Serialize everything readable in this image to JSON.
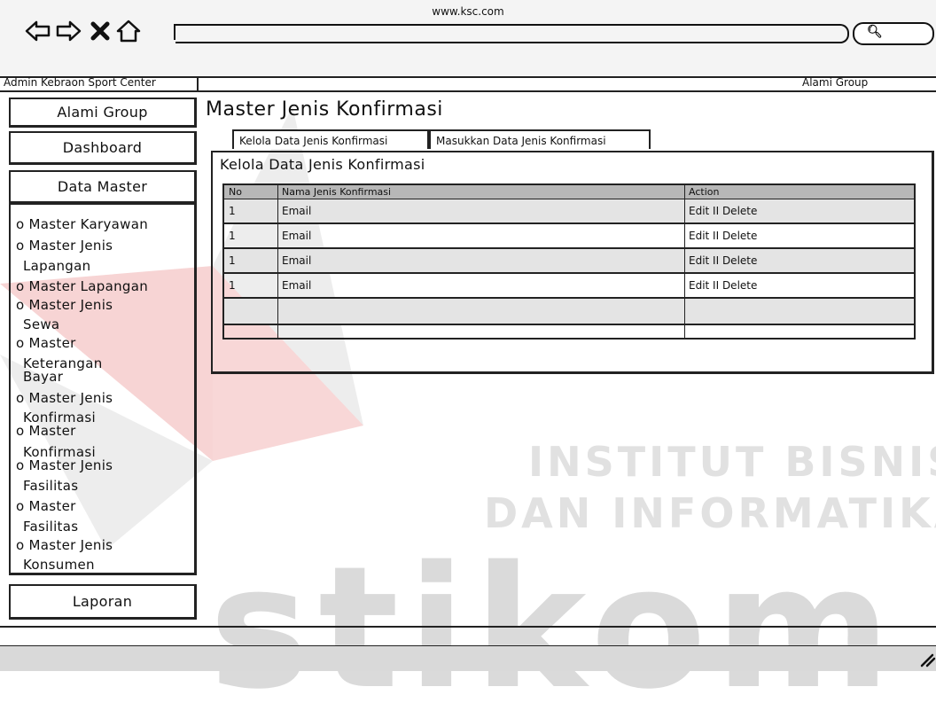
{
  "browser": {
    "url": "www.ksc.com",
    "nav_icons": [
      "back-arrow-icon",
      "forward-arrow-icon",
      "close-icon",
      "home-icon"
    ],
    "search_icon": "search-icon"
  },
  "header": {
    "left": "Admin Kebraon Sport Center",
    "right": "Alami Group"
  },
  "sidebar": {
    "top_buttons": [
      "Alami Group",
      "Dashboard",
      "Data Master"
    ],
    "items": [
      "o Master Karyawan",
      "o Master Jenis",
      "Lapangan",
      "o Master Lapangan",
      "o Master Jenis",
      "Sewa",
      "o Master",
      "Keterangan",
      "Bayar",
      "o Master Jenis",
      "Konfirmasi",
      "o Master",
      "Konfirmasi",
      "o Master Jenis",
      "Fasilitas",
      "o Master",
      "Fasilitas",
      "o Master Jenis",
      "Konsumen"
    ],
    "bottom_button": "Laporan"
  },
  "main": {
    "title": "Master Jenis Konfirmasi",
    "tabs": [
      "Kelola Data Jenis Konfirmasi",
      "Masukkan Data Jenis Konfirmasi"
    ],
    "panel_title": "Kelola Data Jenis Konfirmasi",
    "table": {
      "columns": [
        "No",
        "Nama Jenis Konfirmasi",
        "Action"
      ],
      "rows": [
        [
          "1",
          "Email",
          "Edit II Delete"
        ],
        [
          "1",
          "Email",
          "Edit II Delete"
        ],
        [
          "1",
          "Email",
          "Edit II Delete"
        ],
        [
          "1",
          "Email",
          "Edit II Delete"
        ],
        [
          "",
          "",
          ""
        ],
        [
          "",
          "",
          ""
        ]
      ]
    }
  },
  "watermark": {
    "line1": "INSTITUT BISNIS",
    "line2": "DAN INFORMATIKA",
    "word": "stikom",
    "colors": {
      "red": "#f0a8a8",
      "gray": "#d8d8d8",
      "text": "#e1e1e1"
    }
  }
}
